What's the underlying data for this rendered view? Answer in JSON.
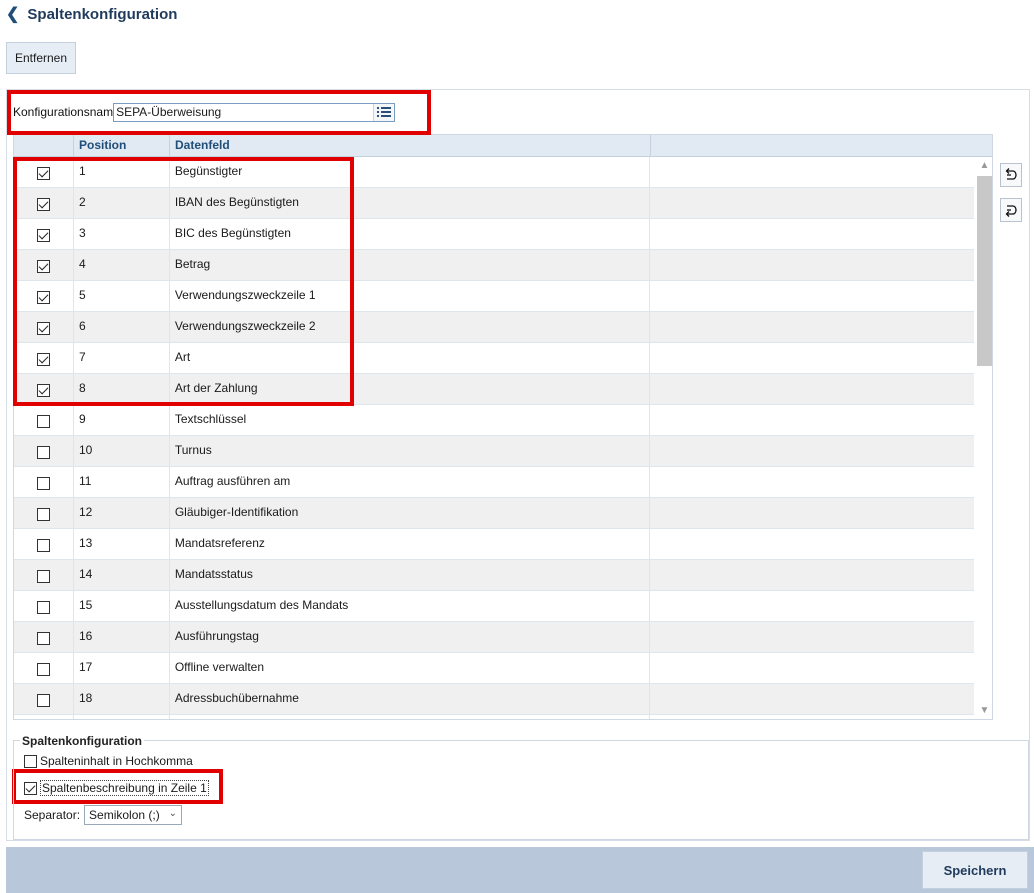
{
  "header": {
    "title": "Spaltenkonfiguration",
    "back_icon": "chevron-left-icon"
  },
  "toolbar": {
    "remove_label": "Entfernen"
  },
  "config": {
    "label": "Konfigurationsnam",
    "value": "SEPA-Überweisung",
    "list_icon": "list-icon"
  },
  "grid": {
    "columns": [
      "Position",
      "Datenfeld"
    ],
    "rows": [
      {
        "checked": true,
        "position": "1",
        "field": "Begünstigter"
      },
      {
        "checked": true,
        "position": "2",
        "field": "IBAN des Begünstigten"
      },
      {
        "checked": true,
        "position": "3",
        "field": "BIC des Begünstigten"
      },
      {
        "checked": true,
        "position": "4",
        "field": "Betrag"
      },
      {
        "checked": true,
        "position": "5",
        "field": "Verwendungszweckzeile 1"
      },
      {
        "checked": true,
        "position": "6",
        "field": "Verwendungszweckzeile 2"
      },
      {
        "checked": true,
        "position": "7",
        "field": "Art"
      },
      {
        "checked": true,
        "position": "8",
        "field": "Art der Zahlung"
      },
      {
        "checked": false,
        "position": "9",
        "field": "Textschlüssel"
      },
      {
        "checked": false,
        "position": "10",
        "field": "Turnus"
      },
      {
        "checked": false,
        "position": "11",
        "field": "Auftrag ausführen am"
      },
      {
        "checked": false,
        "position": "12",
        "field": "Gläubiger-Identifikation"
      },
      {
        "checked": false,
        "position": "13",
        "field": "Mandatsreferenz"
      },
      {
        "checked": false,
        "position": "14",
        "field": "Mandatsstatus"
      },
      {
        "checked": false,
        "position": "15",
        "field": "Ausstellungsdatum des Mandats"
      },
      {
        "checked": false,
        "position": "16",
        "field": "Ausführungstag"
      },
      {
        "checked": false,
        "position": "17",
        "field": "Offline verwalten"
      },
      {
        "checked": false,
        "position": "18",
        "field": "Adressbuchübernahme"
      },
      {
        "checked": false,
        "position": "",
        "field": ""
      }
    ]
  },
  "side_buttons": [
    {
      "icon": "move-up-icon"
    },
    {
      "icon": "move-down-icon"
    }
  ],
  "options": {
    "legend": "Spaltenkonfiguration",
    "quote_label": "Spalteninhalt in Hochkomma",
    "quote_checked": false,
    "header_label": "Spaltenbeschreibung in Zeile 1",
    "header_checked": true,
    "separator_label": "Separator:",
    "separator_value": "Semikolon (;)"
  },
  "footer": {
    "save_label": "Speichern"
  },
  "colors": {
    "accent": "#1f4e79",
    "highlight": "#e00000",
    "footer_bar": "#b8c8da"
  }
}
